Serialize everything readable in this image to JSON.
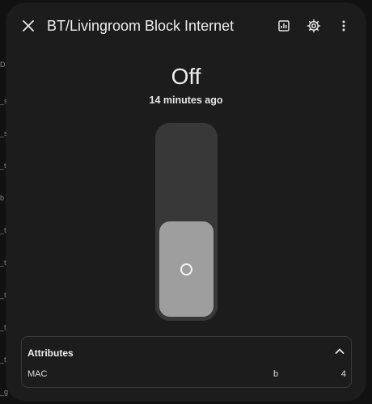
{
  "background": {
    "rows": [
      "D",
      "_s",
      "_s",
      "_t",
      "b",
      "_t",
      "_t",
      "_t",
      "_t",
      "_t",
      "_g",
      "_g"
    ]
  },
  "dialog": {
    "title": "BT/Livingroom Block Internet",
    "close_icon": "close-icon",
    "history_icon": "history-chart-icon",
    "settings_icon": "gear-icon",
    "menu_icon": "more-vertical-icon"
  },
  "state": {
    "value": "Off",
    "last_changed": "14 minutes ago"
  },
  "toggle": {
    "fill_fraction": 0.5,
    "track_color": "#383838",
    "fill_color": "#9e9e9e"
  },
  "attributes": {
    "title": "Attributes",
    "chevron_icon": "chevron-up-icon",
    "rows": [
      {
        "key": "MAC",
        "value_a": "b",
        "value_b": "4"
      }
    ]
  }
}
